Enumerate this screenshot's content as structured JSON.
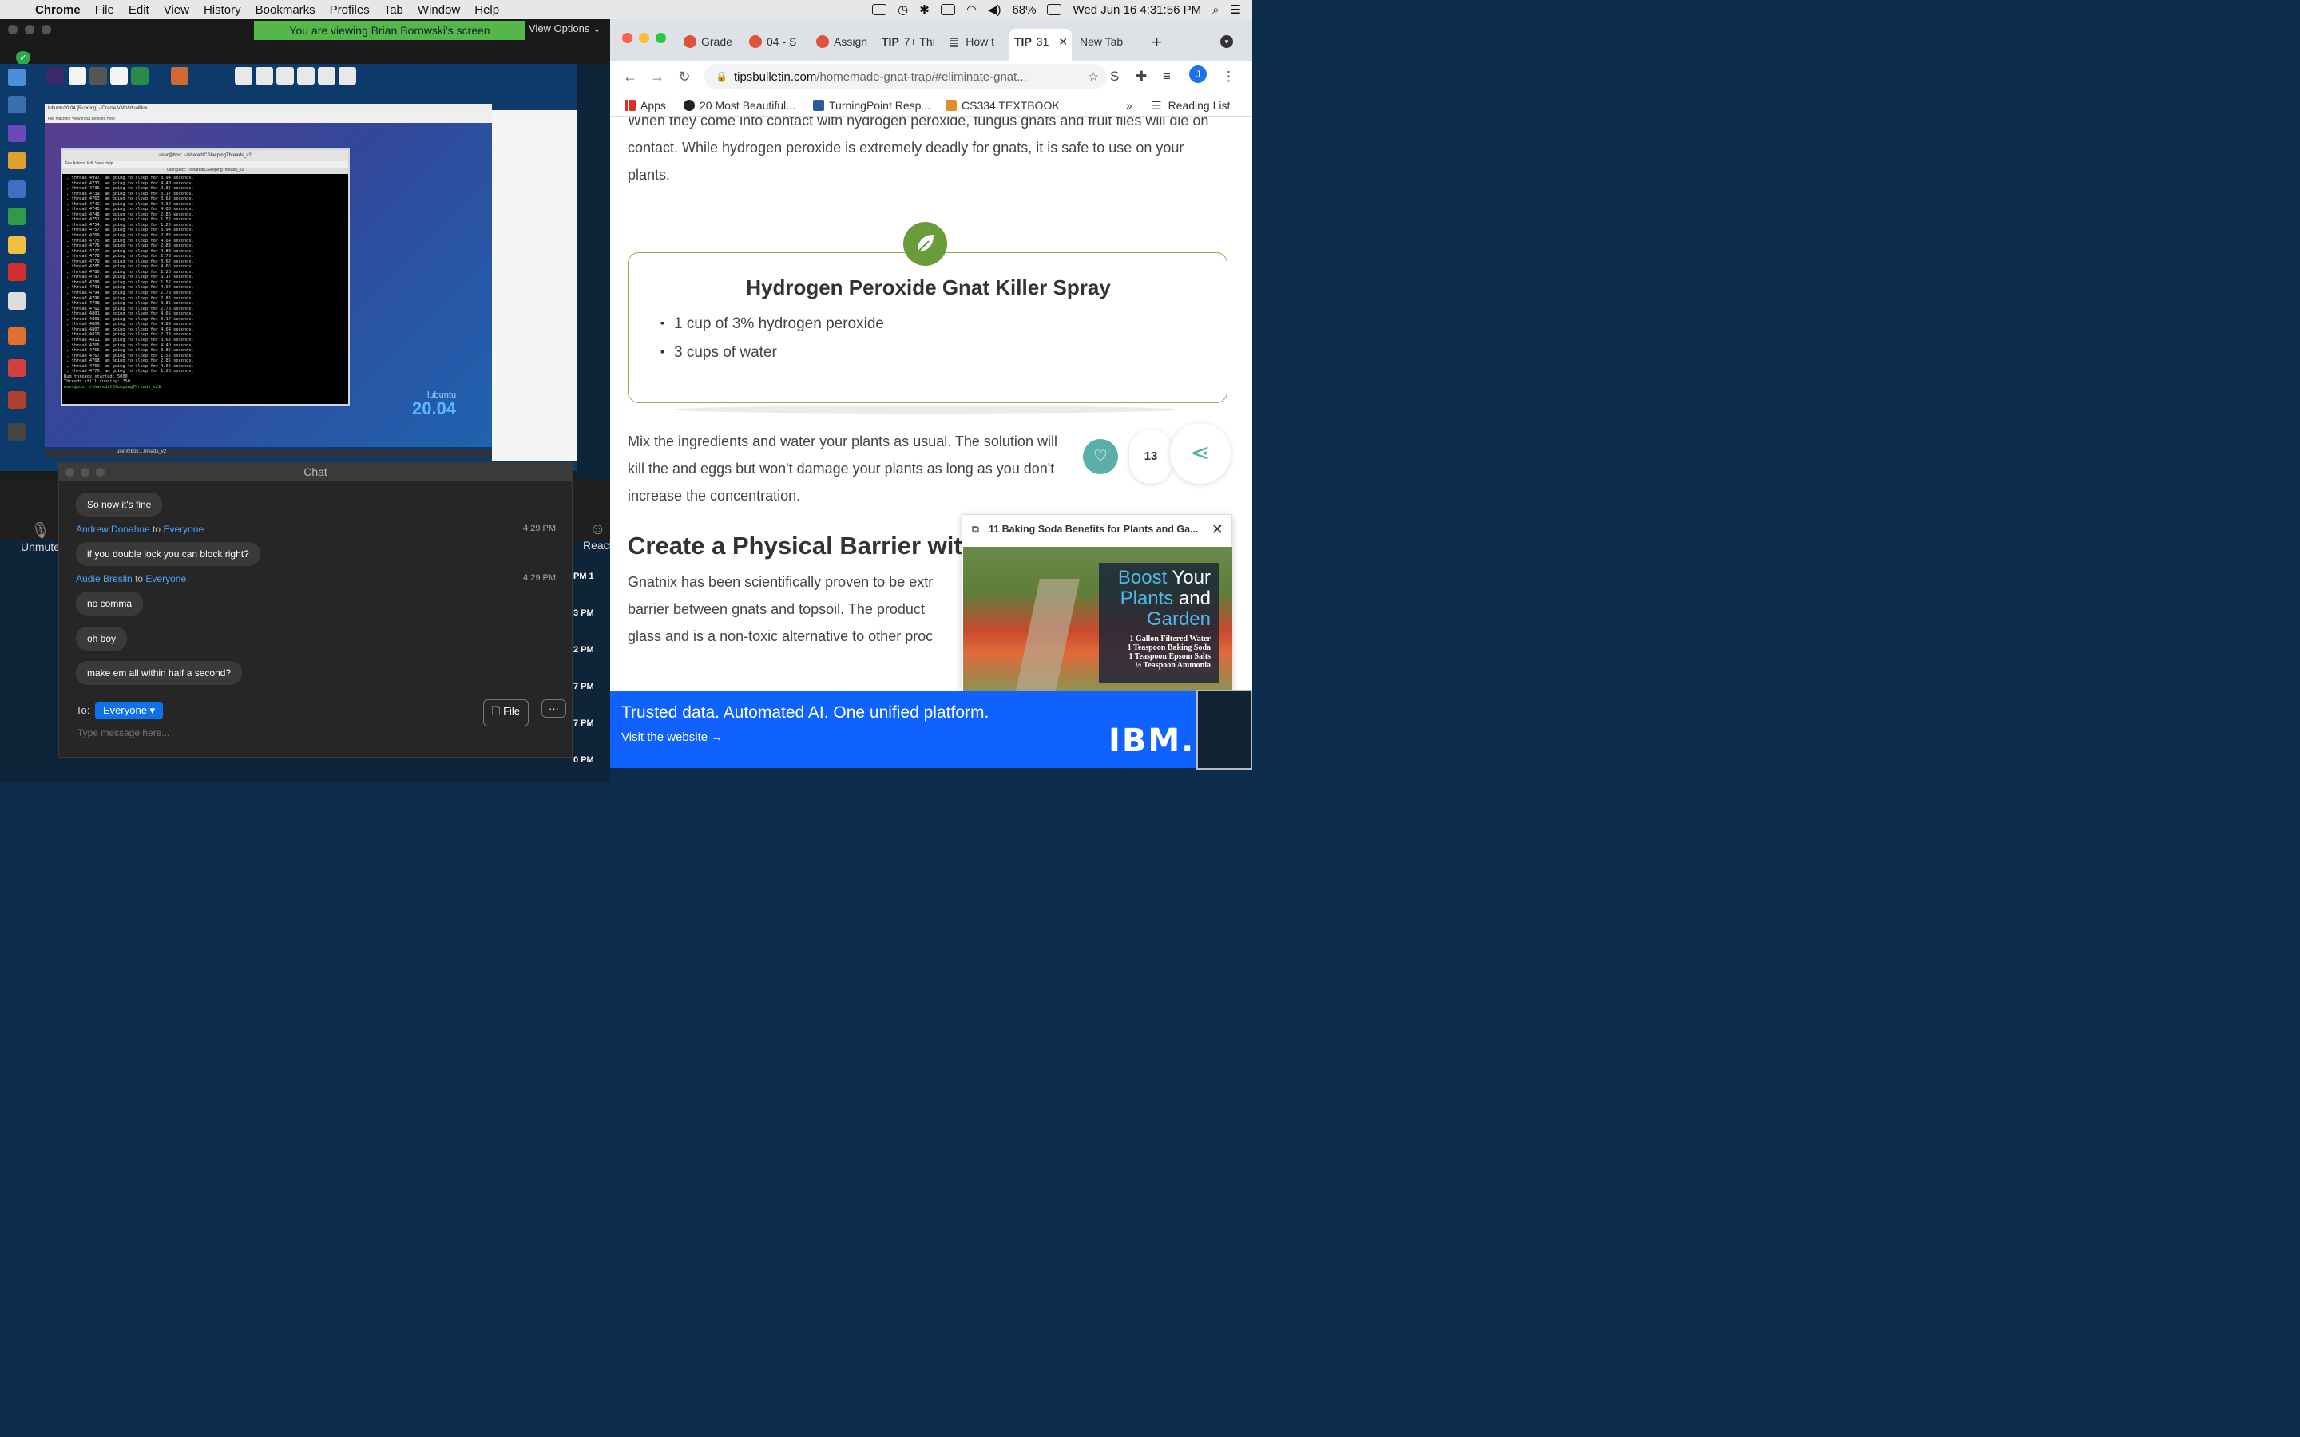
{
  "menubar": {
    "app": "Chrome",
    "items": [
      "File",
      "Edit",
      "View",
      "History",
      "Bookmarks",
      "Profiles",
      "Tab",
      "Window",
      "Help"
    ],
    "battery": "68%",
    "datetime": "Wed Jun 16  4:31:56 PM"
  },
  "zoom": {
    "banner": "You are viewing Brian Borowski's screen",
    "view_options": "View Options",
    "unmute": "Unmute",
    "reactions": "React",
    "time_items": [
      "PM 1",
      "3 PM",
      "2 PM",
      "7 PM",
      "7 PM",
      "0 PM"
    ]
  },
  "shared_screen": {
    "vbox_title": "lubuntu20.04 [Running] - Oracle VM VirtualBox",
    "vbox_menu": "File   Machine   View   Input   Devices   Help",
    "terminal_title": "user@box: ~/shared/CSleepingThreads_v2",
    "terminal_menu": "File   Actions   Edit   View   Help",
    "terminal_tab": "user@box: ~/shared/CSleepingThreads_v2",
    "terminal_lines": [
      "], thread 4997, am going to sleep for 3.94 seconds.",
      "], thread 4733, am going to sleep for 4.40 seconds.",
      "], thread 4736, am going to sleep for 2.85 seconds.",
      "], thread 4739, am going to sleep for 3.17 seconds.",
      "], thread 4763, am going to sleep for 3.62 seconds.",
      "], thread 4742, am going to sleep for 4.32 seconds.",
      "], thread 4745, am going to sleep for 4.83 seconds.",
      "], thread 4748, am going to sleep for 2.86 seconds.",
      "], thread 4751, am going to sleep for 1.52 seconds.",
      "], thread 4754, am going to sleep for 1.20 seconds.",
      "], thread 4757, am going to sleep for 3.94 seconds.",
      "], thread 4760, am going to sleep for 2.83 seconds.",
      "], thread 4775, am going to sleep for 4.64 seconds.",
      "], thread 4776, am going to sleep for 2.83 seconds.",
      "], thread 4777, am going to sleep for 4.83 seconds.",
      "], thread 4778, am going to sleep for 2.78 seconds.",
      "], thread 4779, am going to sleep for 3.62 seconds.",
      "], thread 4785, am going to sleep for 4.65 seconds.",
      "], thread 4786, am going to sleep for 1.20 seconds.",
      "], thread 4787, am going to sleep for 3.17 seconds.",
      "], thread 4788, am going to sleep for 1.52 seconds.",
      "], thread 4791, am going to sleep for 4.64 seconds.",
      "], thread 4794, am going to sleep for 2.78 seconds.",
      "], thread 4796, am going to sleep for 2.86 seconds.",
      "], thread 4798, am going to sleep for 3.85 seconds.",
      "], thread 4762, am going to sleep for 2.78 seconds.",
      "], thread 4801, am going to sleep for 4.65 seconds.",
      "], thread 4803, am going to sleep for 3.17 seconds.",
      "], thread 4809, am going to sleep for 4.83 seconds.",
      "], thread 4807, am going to sleep for 4.64 seconds.",
      "], thread 4810, am going to sleep for 2.78 seconds.",
      "], thread 4811, am going to sleep for 3.62 seconds.",
      "], thread 4765, am going to sleep for 4.40 seconds.",
      "], thread 4766, am going to sleep for 3.85 seconds.",
      "], thread 4767, am going to sleep for 1.52 seconds.",
      "], thread 4768, am going to sleep for 2.85 seconds.",
      "], thread 4769, am going to sleep for 4.65 seconds.",
      "], thread 4770, am going to sleep for 1.20 seconds.",
      "Num threads started: 5000",
      "Threads still running: 150",
      "user@box:~/shared/CSleepingThreads_v2$ "
    ],
    "lubuntu_name": "lubuntu",
    "lubuntu_version": "20.04",
    "taskbar_item": "user@box:...hreads_v2"
  },
  "chat": {
    "title": "Chat",
    "messages": [
      {
        "sender": "Andrew Donahue",
        "to": "to",
        "target": "Everyone",
        "time": "4:29 PM",
        "text": "if you double lock you can block right?"
      },
      {
        "sender": "Audie Breslin",
        "to": "to",
        "target": "Everyone",
        "time": "4:29 PM",
        "text": "no comma"
      }
    ],
    "bubbles": [
      "So now it's fine",
      "if you double lock you can block right?",
      "no comma",
      "oh boy",
      "make em all within half a second?"
    ],
    "to_label": "To:",
    "to_value": "Everyone",
    "file_label": "File",
    "more_label": "···",
    "placeholder": "Type message here..."
  },
  "chrome": {
    "tabs": [
      {
        "label": "Grade",
        "color": "#e0533a"
      },
      {
        "label": "04 - S",
        "color": "#e0533a"
      },
      {
        "label": "Assign",
        "color": "#e0533a"
      },
      {
        "label": "7+ Thi",
        "color": "#222222"
      },
      {
        "label": "How t",
        "color": "#222222"
      },
      {
        "label": "31",
        "color": "#222222"
      },
      {
        "label": "New Tab",
        "color": "#ffffff"
      }
    ],
    "tip_label": "TIP",
    "url_host": "tipsbulletin.com",
    "url_path": "/homemade-gnat-trap/#eliminate-gnat...",
    "profile_initial": "J",
    "bookmarks": [
      "Apps",
      "20 Most Beautiful...",
      "TurningPoint Resp...",
      "CS334 TEXTBOOK"
    ],
    "reading_list": "Reading List"
  },
  "article": {
    "intro": "When they come into contact with hydrogen peroxide, fungus gnats and fruit flies will die on contact. While hydrogen peroxide is extremely deadly for gnats, it is safe to use on your plants.",
    "recipe_title": "Hydrogen Peroxide Gnat Killer Spray",
    "ingredients": [
      "1 cup of 3% hydrogen peroxide",
      "3 cups of water"
    ],
    "mix_text": "Mix the ingredients and water your plants as usual. The solution will kill the and eggs but won't damage your plants as long as you don't increase the concentration.",
    "heading": "Create a Physical Barrier with",
    "gnatnix_text": "Gnatnix has been scientifically proven to be extr barrier between gnats and topsoil. The product glass and is a non-toxic alternative to other proc",
    "like_count": "13"
  },
  "popup": {
    "title": "11 Baking Soda Benefits for Plants and Ga...",
    "img_line1_a": "Boost",
    "img_line1_b": " Your",
    "img_line2_a": "Plants",
    "img_line2_b": " and",
    "img_line3": "Garden",
    "img_ingredients": [
      "1 Gallon Filtered Water",
      "1 Teaspoon Baking Soda",
      "1 Teaspoon Epsom Salts",
      "½ Teaspoon Ammonia"
    ]
  },
  "ad": {
    "headline": "Trusted data. Automated AI. One unified platform.",
    "link": "Visit the website →",
    "logo": "IBM."
  }
}
